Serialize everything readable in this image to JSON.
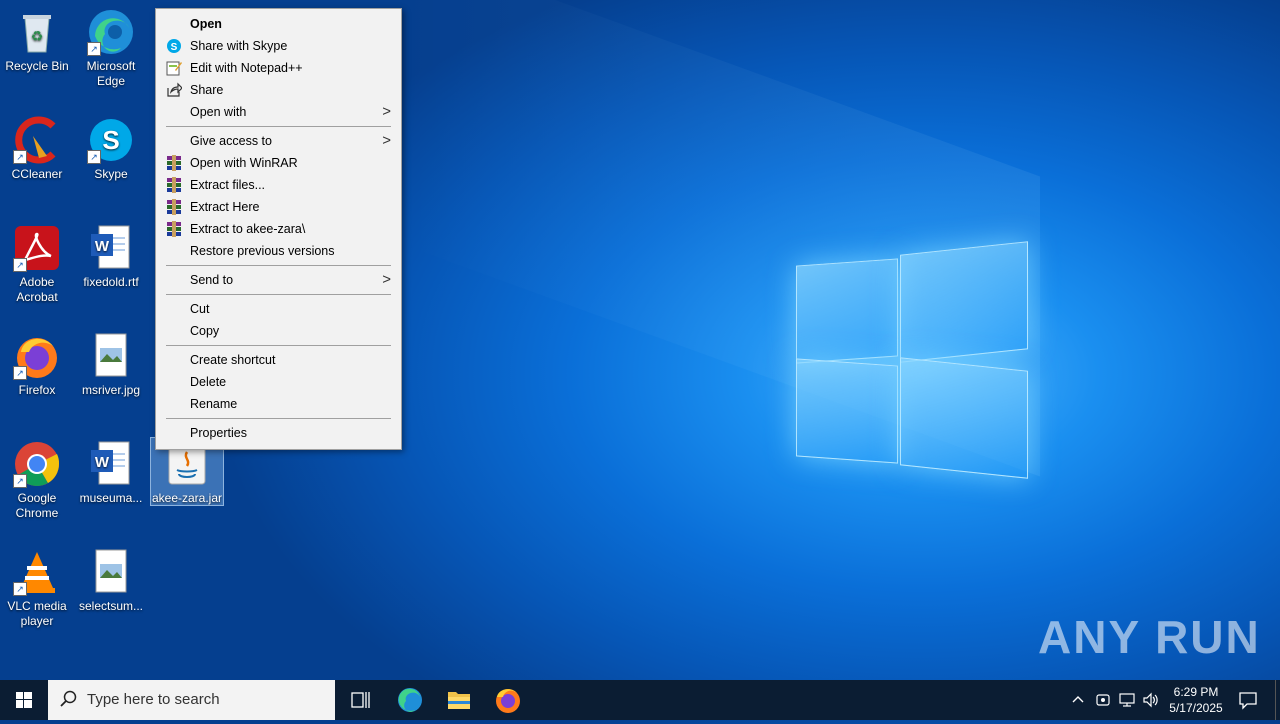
{
  "desktop": {
    "icons": [
      {
        "label": "Recycle Bin"
      },
      {
        "label": "Microsoft Edge"
      },
      {
        "label": "CCleaner"
      },
      {
        "label": "Skype"
      },
      {
        "label": "Adobe Acrobat"
      },
      {
        "label": "fixedold.rtf"
      },
      {
        "label": "Firefox"
      },
      {
        "label": "msriver.jpg"
      },
      {
        "label": "Google Chrome"
      },
      {
        "label": "museuma..."
      },
      {
        "label": "akee-zara.jar"
      },
      {
        "label": "VLC media player"
      },
      {
        "label": "selectsum..."
      }
    ]
  },
  "context_menu": {
    "items": [
      {
        "label": "Open"
      },
      {
        "label": "Share with Skype"
      },
      {
        "label": "Edit with Notepad++"
      },
      {
        "label": "Share"
      },
      {
        "label": "Open with"
      },
      {
        "label": "Give access to"
      },
      {
        "label": "Open with WinRAR"
      },
      {
        "label": "Extract files..."
      },
      {
        "label": "Extract Here"
      },
      {
        "label": "Extract to akee-zara\\"
      },
      {
        "label": "Restore previous versions"
      },
      {
        "label": "Send to"
      },
      {
        "label": "Cut"
      },
      {
        "label": "Copy"
      },
      {
        "label": "Create shortcut"
      },
      {
        "label": "Delete"
      },
      {
        "label": "Rename"
      },
      {
        "label": "Properties"
      }
    ]
  },
  "taskbar": {
    "search_placeholder": "Type here to search",
    "time": "6:29 PM",
    "date": "5/17/2025"
  },
  "watermark": "ANY RUN"
}
